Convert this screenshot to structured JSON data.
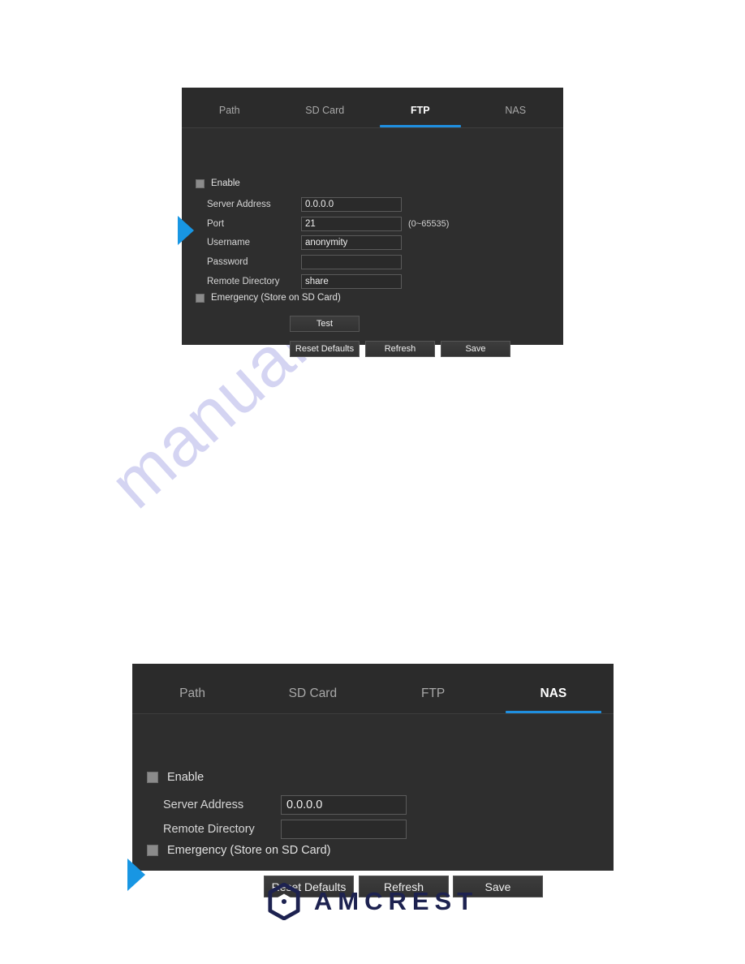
{
  "watermark": {
    "text": "manualshive.com"
  },
  "colors": {
    "panel_bg": "#2e2e2e",
    "header_bg": "#2b2b2b",
    "accent_blue": "#1f8fe0",
    "arrow_blue": "#1896e3",
    "logo_navy": "#1d2250"
  },
  "panel_ftp": {
    "tabs": [
      {
        "label": "Path",
        "active": false
      },
      {
        "label": "SD Card",
        "active": false
      },
      {
        "label": "FTP",
        "active": true
      },
      {
        "label": "NAS",
        "active": false
      }
    ],
    "enable_checkbox": {
      "label": "Enable",
      "checked": false
    },
    "fields": [
      {
        "label": "Server Address",
        "value": "0.0.0.0",
        "hint": ""
      },
      {
        "label": "Port",
        "value": "21",
        "hint": "(0~65535)"
      },
      {
        "label": "Username",
        "value": "anonymity",
        "hint": ""
      },
      {
        "label": "Password",
        "value": "",
        "hint": ""
      },
      {
        "label": "Remote Directory",
        "value": "share",
        "hint": ""
      }
    ],
    "emergency_checkbox": {
      "label": "Emergency (Store on SD Card)",
      "checked": false
    },
    "buttons": {
      "test": "Test",
      "reset_defaults": "Reset Defaults",
      "refresh": "Refresh",
      "save": "Save"
    }
  },
  "panel_nas": {
    "tabs": [
      {
        "label": "Path",
        "active": false
      },
      {
        "label": "SD Card",
        "active": false
      },
      {
        "label": "FTP",
        "active": false
      },
      {
        "label": "NAS",
        "active": true
      }
    ],
    "enable_checkbox": {
      "label": "Enable",
      "checked": false
    },
    "fields": [
      {
        "label": "Server Address",
        "value": "0.0.0.0"
      },
      {
        "label": "Remote Directory",
        "value": ""
      }
    ],
    "emergency_checkbox": {
      "label": "Emergency (Store on SD Card)",
      "checked": false
    },
    "buttons": {
      "reset_defaults": "Reset Defaults",
      "refresh": "Refresh",
      "save": "Save"
    }
  },
  "footer": {
    "brand": "AMCREST",
    "logo_icon": "amcrest-hexagon-icon"
  }
}
